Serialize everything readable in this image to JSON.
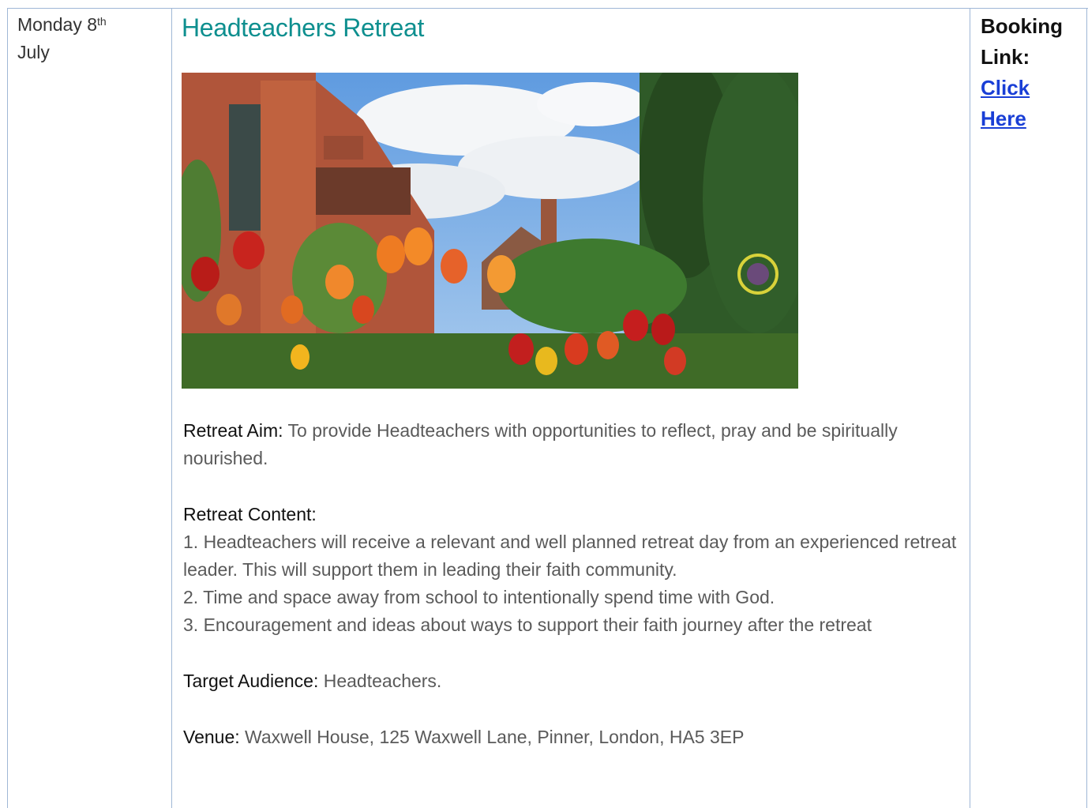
{
  "row": {
    "date_prefix": "Monday 8",
    "date_sup": "th",
    "date_month": "July"
  },
  "event": {
    "title": "Headteachers Retreat",
    "photo_alt": "Retreat house garden with tulips",
    "aim_label": "Retreat Aim:",
    "aim_text": " To provide Headteachers with opportunities to reflect, pray and be spiritually nourished.",
    "content_label": "Retreat Content:",
    "content_items": [
      "1. Headteachers will receive a relevant and well planned retreat day from an experienced retreat leader. This will support them in leading their faith community.",
      "2. Time and space away from school to intentionally spend time with God.",
      "3. Encouragement and ideas about ways to support their faith journey after the retreat"
    ],
    "audience_label": "Target Audience:",
    "audience_text": " Headteachers.",
    "venue_label": "Venue:",
    "venue_text": " Waxwell House, 125 Waxwell Lane, Pinner, London, HA5 3EP"
  },
  "booking": {
    "label_line1": "Booking",
    "label_line2": "Link:",
    "link_line1": "Click",
    "link_line2": "Here"
  },
  "colors": {
    "title": "#0e8f8f",
    "link": "#1a3fd6",
    "border": "#9fb7d6"
  }
}
